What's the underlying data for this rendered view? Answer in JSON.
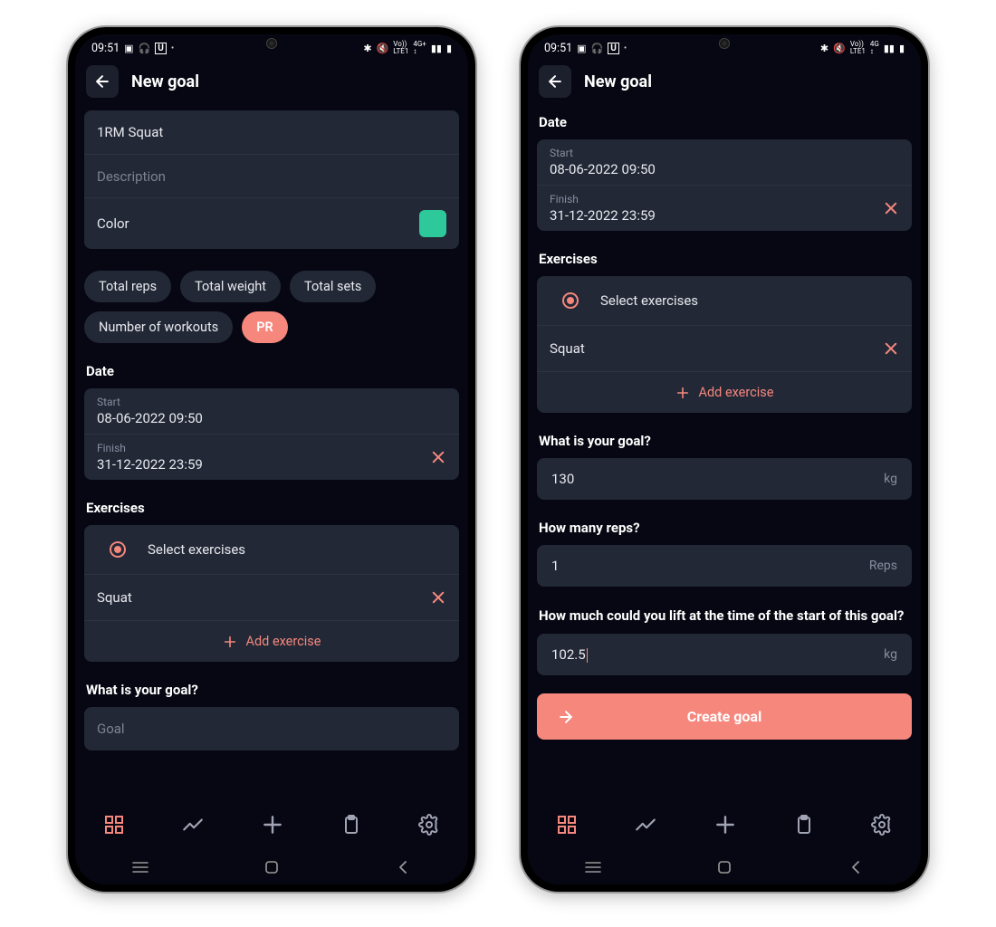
{
  "status": {
    "time": "09:51"
  },
  "header": {
    "title": "New goal"
  },
  "left": {
    "name_value": "1RM Squat",
    "description_placeholder": "Description",
    "color_label": "Color",
    "color_hex": "#2ec99a",
    "chips": [
      {
        "label": "Total reps",
        "active": false
      },
      {
        "label": "Total weight",
        "active": false
      },
      {
        "label": "Total sets",
        "active": false
      },
      {
        "label": "Number of workouts",
        "active": false
      },
      {
        "label": "PR",
        "active": true
      }
    ],
    "date_label": "Date",
    "start_label": "Start",
    "start_value": "08-06-2022 09:50",
    "finish_label": "Finish",
    "finish_value": "31-12-2022 23:59",
    "exercises_label": "Exercises",
    "select_exercises_label": "Select exercises",
    "exercise_item": "Squat",
    "add_exercise_label": "Add exercise",
    "goal_question": "What is your goal?",
    "goal_placeholder": "Goal"
  },
  "right": {
    "date_label": "Date",
    "start_label": "Start",
    "start_value": "08-06-2022 09:50",
    "finish_label": "Finish",
    "finish_value": "31-12-2022 23:59",
    "exercises_label": "Exercises",
    "select_exercises_label": "Select exercises",
    "exercise_item": "Squat",
    "add_exercise_label": "Add exercise",
    "goal_question": "What is your goal?",
    "goal_value": "130",
    "goal_unit": "kg",
    "reps_question": "How many reps?",
    "reps_value": "1",
    "reps_unit": "Reps",
    "baseline_question": "How much could you lift at the time of the start of this goal?",
    "baseline_value": "102.5",
    "baseline_unit": "kg",
    "create_button": "Create goal"
  },
  "accent_color": "#f5877d"
}
